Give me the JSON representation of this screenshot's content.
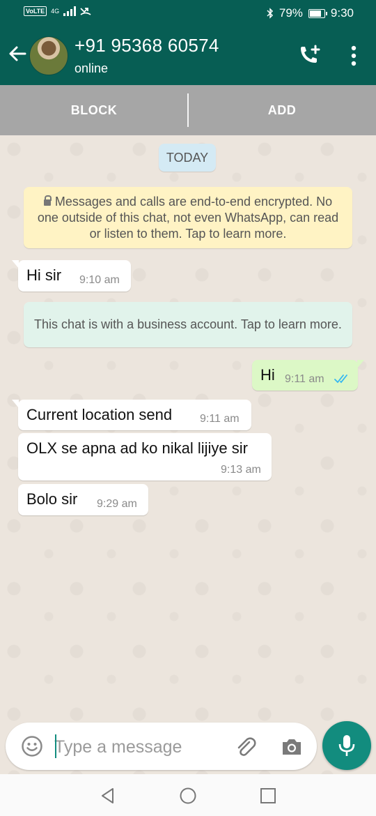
{
  "status_bar": {
    "network_badge": "VoLTE",
    "network_type": "4G",
    "battery_percent": "79%",
    "time": "9:30"
  },
  "header": {
    "contact_name": "+91 95368 60574",
    "contact_status": "online"
  },
  "business_actions": {
    "block_label": "BLOCK",
    "add_label": "ADD"
  },
  "chat": {
    "date_chip": "TODAY",
    "encryption_notice": "Messages and calls are end-to-end encrypted. No one outside of this chat, not even WhatsApp, can read or listen to them. Tap to learn more.",
    "business_notice": "This chat is with a business account. Tap to learn more.",
    "messages": [
      {
        "direction": "in",
        "text": "Hi sir",
        "time": "9:10 am"
      },
      {
        "direction": "out",
        "text": "Hi",
        "time": "9:11 am",
        "status": "read"
      },
      {
        "direction": "in",
        "text": "Current location send",
        "time": "9:11 am"
      },
      {
        "direction": "in",
        "text": "OLX se apna ad ko nikal lijiye sir",
        "time": "9:13 am"
      },
      {
        "direction": "in",
        "text": "Bolo sir",
        "time": "9:29 am"
      }
    ]
  },
  "composer": {
    "placeholder": "Type a message"
  },
  "colors": {
    "header": "#075E54",
    "accent": "#128C7E",
    "outgoing_bubble": "#DCF8C6",
    "read_ticks": "#34B7F1"
  },
  "icons": [
    "back-arrow-icon",
    "add-call-icon",
    "more-options-icon",
    "emoji-icon",
    "attach-icon",
    "camera-icon",
    "mic-icon",
    "lock-icon",
    "double-check-icon"
  ]
}
